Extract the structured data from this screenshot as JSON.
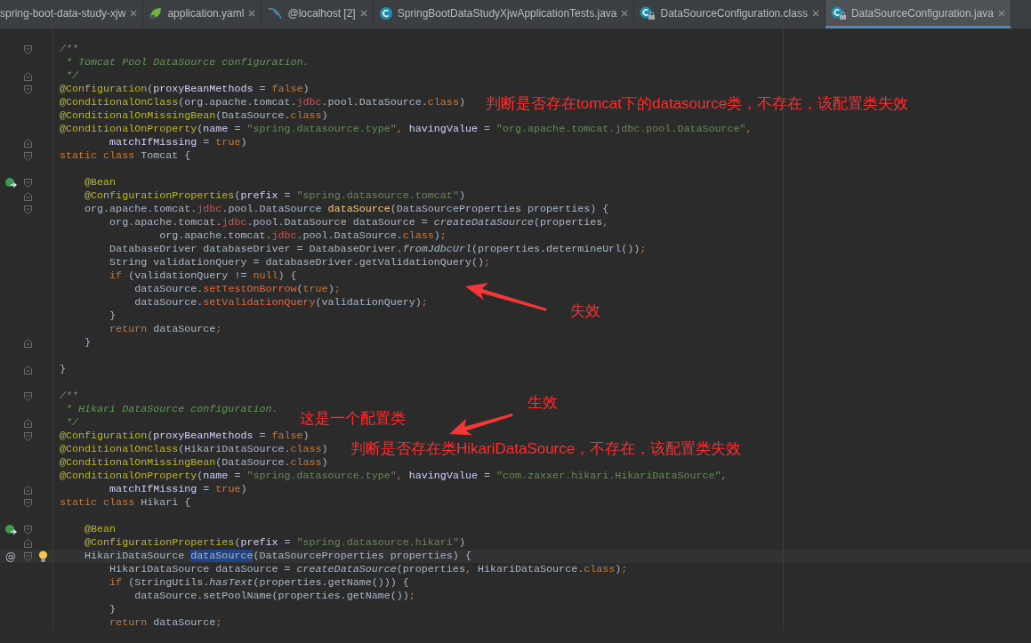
{
  "tabs": [
    {
      "label": "spring-boot-data-study-xjw",
      "selected": false
    },
    {
      "label": "application.yaml",
      "selected": false,
      "kind": "yaml"
    },
    {
      "label": "@localhost [2]",
      "selected": false,
      "kind": "database"
    },
    {
      "label": "SpringBootDataStudyXjwApplicationTests.java",
      "selected": false,
      "kind": "class"
    },
    {
      "label": "DataSourceConfiguration.class",
      "selected": false,
      "kind": "locked-class"
    },
    {
      "label": "DataSourceConfiguration.java",
      "selected": true,
      "kind": "locked-class"
    }
  ],
  "editor": {
    "lines": [
      {
        "kind": "blank"
      },
      {
        "kind": "code",
        "fold": {
          "kind": "open"
        },
        "segments": [
          {
            "kind": "comment",
            "text": "/**"
          }
        ]
      },
      {
        "kind": "code",
        "segments": [
          {
            "kind": "comment",
            "text": " * Tomcat Pool DataSource configuration."
          }
        ]
      },
      {
        "kind": "code",
        "fold": {
          "kind": "close"
        },
        "segments": [
          {
            "kind": "comment",
            "text": " */"
          }
        ]
      },
      {
        "kind": "code",
        "fold": {
          "kind": "open"
        },
        "segments": [
          {
            "kind": "annotation",
            "text": "@Configuration"
          },
          {
            "kind": "plain",
            "text": "("
          },
          {
            "kind": "param",
            "text": "proxyBeanMethods"
          },
          {
            "kind": "plain",
            "text": " = "
          },
          {
            "kind": "keyword",
            "text": "false"
          },
          {
            "kind": "plain",
            "text": ")"
          }
        ]
      },
      {
        "kind": "code",
        "segments": [
          {
            "kind": "annotation",
            "text": "@ConditionalOnClass"
          },
          {
            "kind": "plain",
            "text": "(org.apache.tomcat."
          },
          {
            "kind": "unresolved",
            "text": "jdbc"
          },
          {
            "kind": "plain",
            "text": ".pool.DataSource."
          },
          {
            "kind": "keyword",
            "text": "class"
          },
          {
            "kind": "plain",
            "text": ")"
          }
        ]
      },
      {
        "kind": "code",
        "segments": [
          {
            "kind": "annotation",
            "text": "@ConditionalOnMissingBean"
          },
          {
            "kind": "plain",
            "text": "(DataSource."
          },
          {
            "kind": "keyword",
            "text": "class"
          },
          {
            "kind": "plain",
            "text": ")"
          }
        ]
      },
      {
        "kind": "code",
        "segments": [
          {
            "kind": "annotation",
            "text": "@ConditionalOnProperty"
          },
          {
            "kind": "plain",
            "text": "("
          },
          {
            "kind": "param",
            "text": "name"
          },
          {
            "kind": "plain",
            "text": " = "
          },
          {
            "kind": "string",
            "text": "\"spring.datasource.type\""
          },
          {
            "kind": "keyword",
            "text": ", "
          },
          {
            "kind": "param",
            "text": "havingValue"
          },
          {
            "kind": "plain",
            "text": " = "
          },
          {
            "kind": "string",
            "text": "\"org.apache.tomcat.jdbc.pool.DataSource\""
          },
          {
            "kind": "keyword",
            "text": ","
          }
        ]
      },
      {
        "kind": "code",
        "fold": {
          "kind": "close"
        },
        "segments": [
          {
            "kind": "param",
            "text": "        matchIfMissing"
          },
          {
            "kind": "plain",
            "text": " = "
          },
          {
            "kind": "keyword",
            "text": "true"
          },
          {
            "kind": "plain",
            "text": ")"
          }
        ]
      },
      {
        "kind": "code",
        "fold": {
          "kind": "open"
        },
        "segments": [
          {
            "kind": "keyword",
            "text": "static class "
          },
          {
            "kind": "plain",
            "text": "Tomcat {"
          }
        ]
      },
      {
        "kind": "blank"
      },
      {
        "kind": "code",
        "marker": {
          "kind": "bean"
        },
        "fold": {
          "kind": "open"
        },
        "segments": [
          {
            "kind": "annotation",
            "text": "    @Bean"
          }
        ]
      },
      {
        "kind": "code",
        "fold": {
          "kind": "close"
        },
        "segments": [
          {
            "kind": "annotation",
            "text": "    @ConfigurationProperties"
          },
          {
            "kind": "plain",
            "text": "("
          },
          {
            "kind": "param",
            "text": "prefix"
          },
          {
            "kind": "plain",
            "text": " = "
          },
          {
            "kind": "string",
            "text": "\"spring.datasource.tomcat\""
          },
          {
            "kind": "plain",
            "text": ")"
          }
        ]
      },
      {
        "kind": "code",
        "fold": {
          "kind": "open"
        },
        "segments": [
          {
            "kind": "plain",
            "text": "    org.apache.tomcat."
          },
          {
            "kind": "unresolved",
            "text": "jdbc"
          },
          {
            "kind": "plain",
            "text": ".pool.DataSource "
          },
          {
            "kind": "method",
            "text": "dataSource"
          },
          {
            "kind": "plain",
            "text": "(DataSourceProperties properties) {"
          }
        ]
      },
      {
        "kind": "code",
        "segments": [
          {
            "kind": "plain",
            "text": "        org.apache.tomcat."
          },
          {
            "kind": "unresolved",
            "text": "jdbc"
          },
          {
            "kind": "plain",
            "text": ".pool.DataSource dataSource = "
          },
          {
            "kind": "static-call",
            "text": "createDataSource"
          },
          {
            "kind": "plain",
            "text": "(properties"
          },
          {
            "kind": "keyword",
            "text": ","
          }
        ]
      },
      {
        "kind": "code",
        "segments": [
          {
            "kind": "plain",
            "text": "                org.apache.tomcat."
          },
          {
            "kind": "unresolved",
            "text": "jdbc"
          },
          {
            "kind": "plain",
            "text": ".pool.DataSource."
          },
          {
            "kind": "keyword",
            "text": "class"
          },
          {
            "kind": "plain",
            "text": ")"
          },
          {
            "kind": "keyword",
            "text": ";"
          }
        ]
      },
      {
        "kind": "code",
        "segments": [
          {
            "kind": "plain",
            "text": "        DatabaseDriver databaseDriver = DatabaseDriver."
          },
          {
            "kind": "static-call",
            "text": "fromJdbcUrl"
          },
          {
            "kind": "plain",
            "text": "(properties.determineUrl())"
          },
          {
            "kind": "keyword",
            "text": ";"
          }
        ]
      },
      {
        "kind": "code",
        "segments": [
          {
            "kind": "plain",
            "text": "        String validationQuery = databaseDriver.getValidationQuery()"
          },
          {
            "kind": "keyword",
            "text": ";"
          }
        ]
      },
      {
        "kind": "code",
        "segments": [
          {
            "kind": "keyword",
            "text": "        if "
          },
          {
            "kind": "plain",
            "text": "(validationQuery != "
          },
          {
            "kind": "keyword",
            "text": "null"
          },
          {
            "kind": "plain",
            "text": ") {"
          }
        ]
      },
      {
        "kind": "code",
        "segments": [
          {
            "kind": "plain",
            "text": "            dataSource."
          },
          {
            "kind": "unresolved-call",
            "text": "setTestOnBorrow"
          },
          {
            "kind": "plain",
            "text": "("
          },
          {
            "kind": "keyword",
            "text": "true"
          },
          {
            "kind": "plain",
            "text": ")"
          },
          {
            "kind": "keyword",
            "text": ";"
          }
        ]
      },
      {
        "kind": "code",
        "segments": [
          {
            "kind": "plain",
            "text": "            dataSource."
          },
          {
            "kind": "unresolved-call",
            "text": "setValidationQuery"
          },
          {
            "kind": "plain",
            "text": "(validationQuery)"
          },
          {
            "kind": "keyword",
            "text": ";"
          }
        ]
      },
      {
        "kind": "code",
        "segments": [
          {
            "kind": "plain",
            "text": "        }"
          }
        ]
      },
      {
        "kind": "code",
        "segments": [
          {
            "kind": "keyword",
            "text": "        return "
          },
          {
            "kind": "plain",
            "text": "dataSource"
          },
          {
            "kind": "keyword",
            "text": ";"
          }
        ]
      },
      {
        "kind": "code",
        "fold": {
          "kind": "close"
        },
        "segments": [
          {
            "kind": "plain",
            "text": "    }"
          }
        ]
      },
      {
        "kind": "blank"
      },
      {
        "kind": "code",
        "fold": {
          "kind": "close"
        },
        "segments": [
          {
            "kind": "plain",
            "text": "}"
          }
        ]
      },
      {
        "kind": "blank"
      },
      {
        "kind": "code",
        "fold": {
          "kind": "open"
        },
        "segments": [
          {
            "kind": "comment",
            "text": "/**"
          }
        ]
      },
      {
        "kind": "code",
        "segments": [
          {
            "kind": "comment",
            "text": " * Hikari DataSource configuration."
          }
        ]
      },
      {
        "kind": "code",
        "fold": {
          "kind": "close"
        },
        "segments": [
          {
            "kind": "comment",
            "text": " */"
          }
        ]
      },
      {
        "kind": "code",
        "fold": {
          "kind": "open"
        },
        "segments": [
          {
            "kind": "annotation",
            "text": "@Configuration"
          },
          {
            "kind": "plain",
            "text": "("
          },
          {
            "kind": "param",
            "text": "proxyBeanMethods"
          },
          {
            "kind": "plain",
            "text": " = "
          },
          {
            "kind": "keyword",
            "text": "false"
          },
          {
            "kind": "plain",
            "text": ")"
          }
        ]
      },
      {
        "kind": "code",
        "segments": [
          {
            "kind": "annotation",
            "text": "@ConditionalOnClass"
          },
          {
            "kind": "plain",
            "text": "(HikariDataSource."
          },
          {
            "kind": "keyword",
            "text": "class"
          },
          {
            "kind": "plain",
            "text": ")"
          }
        ]
      },
      {
        "kind": "code",
        "segments": [
          {
            "kind": "annotation",
            "text": "@ConditionalOnMissingBean"
          },
          {
            "kind": "plain",
            "text": "(DataSource."
          },
          {
            "kind": "keyword",
            "text": "class"
          },
          {
            "kind": "plain",
            "text": ")"
          }
        ]
      },
      {
        "kind": "code",
        "segments": [
          {
            "kind": "annotation",
            "text": "@ConditionalOnProperty"
          },
          {
            "kind": "plain",
            "text": "("
          },
          {
            "kind": "param",
            "text": "name"
          },
          {
            "kind": "plain",
            "text": " = "
          },
          {
            "kind": "string",
            "text": "\"spring.datasource.type\""
          },
          {
            "kind": "keyword",
            "text": ", "
          },
          {
            "kind": "param",
            "text": "havingValue"
          },
          {
            "kind": "plain",
            "text": " = "
          },
          {
            "kind": "string",
            "text": "\"com.zaxxer.hikari.HikariDataSource\""
          },
          {
            "kind": "keyword",
            "text": ","
          }
        ]
      },
      {
        "kind": "code",
        "fold": {
          "kind": "close"
        },
        "segments": [
          {
            "kind": "param",
            "text": "        matchIfMissing"
          },
          {
            "kind": "plain",
            "text": " = "
          },
          {
            "kind": "keyword",
            "text": "true"
          },
          {
            "kind": "plain",
            "text": ")"
          }
        ]
      },
      {
        "kind": "code",
        "fold": {
          "kind": "open"
        },
        "segments": [
          {
            "kind": "keyword",
            "text": "static class "
          },
          {
            "kind": "plain",
            "text": "Hikari {"
          }
        ]
      },
      {
        "kind": "blank"
      },
      {
        "kind": "code",
        "marker": {
          "kind": "bean"
        },
        "fold": {
          "kind": "open"
        },
        "segments": [
          {
            "kind": "annotation",
            "text": "    @Bean"
          }
        ]
      },
      {
        "kind": "code",
        "fold": {
          "kind": "close"
        },
        "segments": [
          {
            "kind": "annotation",
            "text": "    @ConfigurationProperties"
          },
          {
            "kind": "plain",
            "text": "("
          },
          {
            "kind": "param",
            "text": "prefix"
          },
          {
            "kind": "plain",
            "text": " = "
          },
          {
            "kind": "string",
            "text": "\"spring.datasource.hikari\""
          },
          {
            "kind": "plain",
            "text": ")"
          }
        ]
      },
      {
        "kind": "code",
        "current": true,
        "gutter_text": "@",
        "bulb": true,
        "fold": {
          "kind": "open"
        },
        "segments": [
          {
            "kind": "plain",
            "text": "    HikariDataSource "
          },
          {
            "kind": "selected",
            "text": "dataSource"
          },
          {
            "kind": "plain",
            "text": "(DataSourceProperties properties) {"
          }
        ]
      },
      {
        "kind": "code",
        "segments": [
          {
            "kind": "plain",
            "text": "        HikariDataSource dataSource = "
          },
          {
            "kind": "static-call",
            "text": "createDataSource"
          },
          {
            "kind": "plain",
            "text": "(properties"
          },
          {
            "kind": "keyword",
            "text": ","
          },
          {
            "kind": "plain",
            "text": " HikariDataSource."
          },
          {
            "kind": "keyword",
            "text": "class"
          },
          {
            "kind": "plain",
            "text": ")"
          },
          {
            "kind": "keyword",
            "text": ";"
          }
        ]
      },
      {
        "kind": "code",
        "segments": [
          {
            "kind": "keyword",
            "text": "        if "
          },
          {
            "kind": "plain",
            "text": "(StringUtils."
          },
          {
            "kind": "static-call",
            "text": "hasText"
          },
          {
            "kind": "plain",
            "text": "(properties.getName())) {"
          }
        ]
      },
      {
        "kind": "code",
        "segments": [
          {
            "kind": "plain",
            "text": "            dataSource.setPoolName(properties.getName())"
          },
          {
            "kind": "keyword",
            "text": ";"
          }
        ]
      },
      {
        "kind": "code",
        "segments": [
          {
            "kind": "plain",
            "text": "        }"
          }
        ]
      },
      {
        "kind": "code",
        "segments": [
          {
            "kind": "keyword",
            "text": "        return "
          },
          {
            "kind": "plain",
            "text": "dataSource"
          },
          {
            "kind": "keyword",
            "text": ";"
          }
        ]
      }
    ]
  },
  "notes": [
    {
      "kind": "text",
      "text": "判断是否存在tomcat下的datasource类，不存在，该配置类失效"
    },
    {
      "kind": "arrow"
    },
    {
      "kind": "text",
      "text": "失效"
    },
    {
      "kind": "text",
      "text": "生效"
    },
    {
      "kind": "text",
      "text": "这是一个配置类"
    },
    {
      "kind": "arrow"
    },
    {
      "kind": "text",
      "text": "判断是否存在类HikariDataSource，不存在，该配置类失效"
    }
  ]
}
